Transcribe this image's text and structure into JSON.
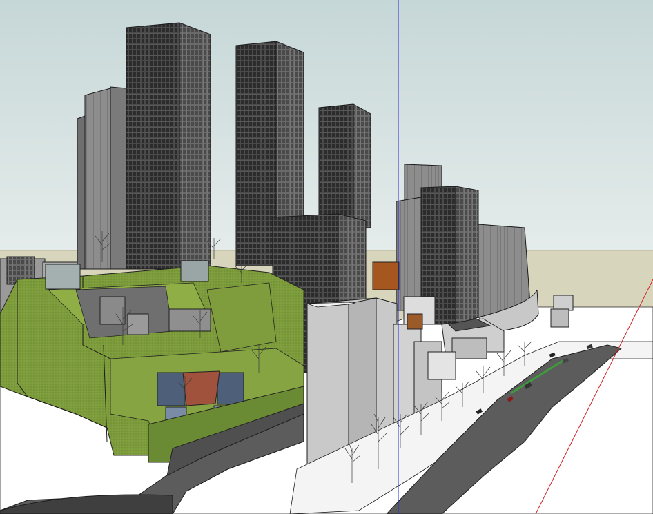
{
  "viewport": {
    "sky_top_color": "#c6d7d7",
    "sky_bottom_color": "#e3ecea",
    "ground_color": "#d8d5bd",
    "axis_blue": "#2b2bd6",
    "axis_red": "#d12020"
  },
  "icons": [
    "tree-icon",
    "car-icon"
  ]
}
